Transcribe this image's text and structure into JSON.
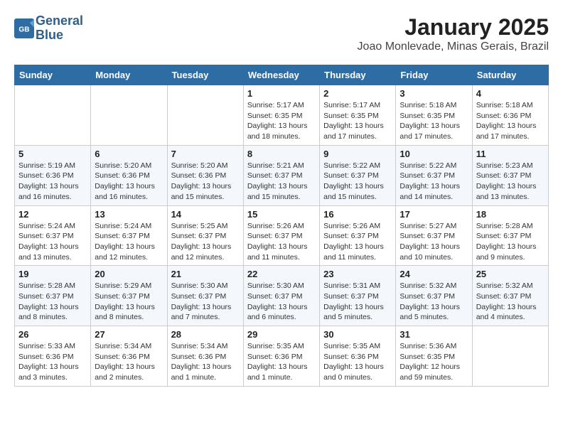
{
  "header": {
    "logo_line1": "General",
    "logo_line2": "Blue",
    "title": "January 2025",
    "subtitle": "Joao Monlevade, Minas Gerais, Brazil"
  },
  "weekdays": [
    "Sunday",
    "Monday",
    "Tuesday",
    "Wednesday",
    "Thursday",
    "Friday",
    "Saturday"
  ],
  "weeks": [
    [
      {
        "day": "",
        "info": ""
      },
      {
        "day": "",
        "info": ""
      },
      {
        "day": "",
        "info": ""
      },
      {
        "day": "1",
        "info": "Sunrise: 5:17 AM\nSunset: 6:35 PM\nDaylight: 13 hours\nand 18 minutes."
      },
      {
        "day": "2",
        "info": "Sunrise: 5:17 AM\nSunset: 6:35 PM\nDaylight: 13 hours\nand 17 minutes."
      },
      {
        "day": "3",
        "info": "Sunrise: 5:18 AM\nSunset: 6:35 PM\nDaylight: 13 hours\nand 17 minutes."
      },
      {
        "day": "4",
        "info": "Sunrise: 5:18 AM\nSunset: 6:36 PM\nDaylight: 13 hours\nand 17 minutes."
      }
    ],
    [
      {
        "day": "5",
        "info": "Sunrise: 5:19 AM\nSunset: 6:36 PM\nDaylight: 13 hours\nand 16 minutes."
      },
      {
        "day": "6",
        "info": "Sunrise: 5:20 AM\nSunset: 6:36 PM\nDaylight: 13 hours\nand 16 minutes."
      },
      {
        "day": "7",
        "info": "Sunrise: 5:20 AM\nSunset: 6:36 PM\nDaylight: 13 hours\nand 15 minutes."
      },
      {
        "day": "8",
        "info": "Sunrise: 5:21 AM\nSunset: 6:37 PM\nDaylight: 13 hours\nand 15 minutes."
      },
      {
        "day": "9",
        "info": "Sunrise: 5:22 AM\nSunset: 6:37 PM\nDaylight: 13 hours\nand 15 minutes."
      },
      {
        "day": "10",
        "info": "Sunrise: 5:22 AM\nSunset: 6:37 PM\nDaylight: 13 hours\nand 14 minutes."
      },
      {
        "day": "11",
        "info": "Sunrise: 5:23 AM\nSunset: 6:37 PM\nDaylight: 13 hours\nand 13 minutes."
      }
    ],
    [
      {
        "day": "12",
        "info": "Sunrise: 5:24 AM\nSunset: 6:37 PM\nDaylight: 13 hours\nand 13 minutes."
      },
      {
        "day": "13",
        "info": "Sunrise: 5:24 AM\nSunset: 6:37 PM\nDaylight: 13 hours\nand 12 minutes."
      },
      {
        "day": "14",
        "info": "Sunrise: 5:25 AM\nSunset: 6:37 PM\nDaylight: 13 hours\nand 12 minutes."
      },
      {
        "day": "15",
        "info": "Sunrise: 5:26 AM\nSunset: 6:37 PM\nDaylight: 13 hours\nand 11 minutes."
      },
      {
        "day": "16",
        "info": "Sunrise: 5:26 AM\nSunset: 6:37 PM\nDaylight: 13 hours\nand 11 minutes."
      },
      {
        "day": "17",
        "info": "Sunrise: 5:27 AM\nSunset: 6:37 PM\nDaylight: 13 hours\nand 10 minutes."
      },
      {
        "day": "18",
        "info": "Sunrise: 5:28 AM\nSunset: 6:37 PM\nDaylight: 13 hours\nand 9 minutes."
      }
    ],
    [
      {
        "day": "19",
        "info": "Sunrise: 5:28 AM\nSunset: 6:37 PM\nDaylight: 13 hours\nand 8 minutes."
      },
      {
        "day": "20",
        "info": "Sunrise: 5:29 AM\nSunset: 6:37 PM\nDaylight: 13 hours\nand 8 minutes."
      },
      {
        "day": "21",
        "info": "Sunrise: 5:30 AM\nSunset: 6:37 PM\nDaylight: 13 hours\nand 7 minutes."
      },
      {
        "day": "22",
        "info": "Sunrise: 5:30 AM\nSunset: 6:37 PM\nDaylight: 13 hours\nand 6 minutes."
      },
      {
        "day": "23",
        "info": "Sunrise: 5:31 AM\nSunset: 6:37 PM\nDaylight: 13 hours\nand 5 minutes."
      },
      {
        "day": "24",
        "info": "Sunrise: 5:32 AM\nSunset: 6:37 PM\nDaylight: 13 hours\nand 5 minutes."
      },
      {
        "day": "25",
        "info": "Sunrise: 5:32 AM\nSunset: 6:37 PM\nDaylight: 13 hours\nand 4 minutes."
      }
    ],
    [
      {
        "day": "26",
        "info": "Sunrise: 5:33 AM\nSunset: 6:36 PM\nDaylight: 13 hours\nand 3 minutes."
      },
      {
        "day": "27",
        "info": "Sunrise: 5:34 AM\nSunset: 6:36 PM\nDaylight: 13 hours\nand 2 minutes."
      },
      {
        "day": "28",
        "info": "Sunrise: 5:34 AM\nSunset: 6:36 PM\nDaylight: 13 hours\nand 1 minute."
      },
      {
        "day": "29",
        "info": "Sunrise: 5:35 AM\nSunset: 6:36 PM\nDaylight: 13 hours\nand 1 minute."
      },
      {
        "day": "30",
        "info": "Sunrise: 5:35 AM\nSunset: 6:36 PM\nDaylight: 13 hours\nand 0 minutes."
      },
      {
        "day": "31",
        "info": "Sunrise: 5:36 AM\nSunset: 6:35 PM\nDaylight: 12 hours\nand 59 minutes."
      },
      {
        "day": "",
        "info": ""
      }
    ]
  ]
}
